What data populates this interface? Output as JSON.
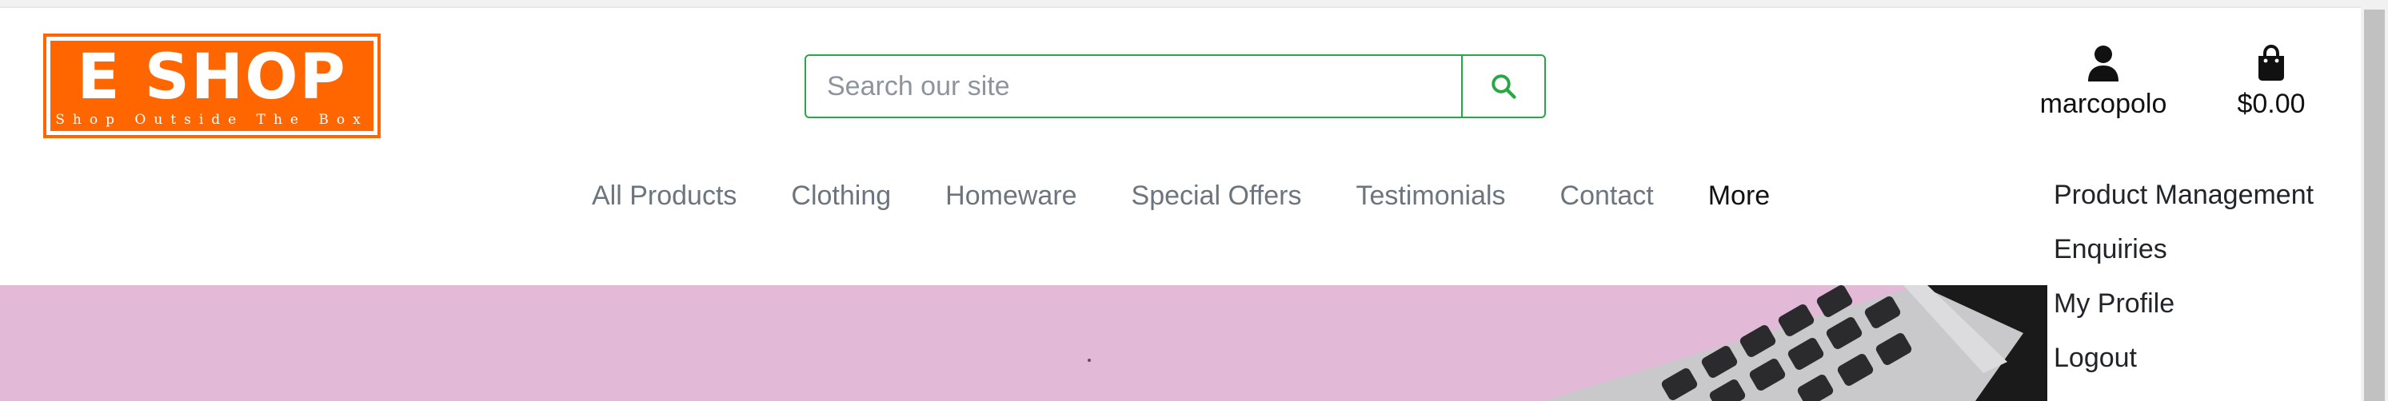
{
  "brand": {
    "title": "E SHOP",
    "tagline": "Shop Outside The Box",
    "color": "#ff6600"
  },
  "search": {
    "placeholder": "Search our site",
    "value": "",
    "button_icon": "search-icon",
    "accent": "#28a745"
  },
  "account": {
    "icon": "user-icon",
    "label": "marcopolo"
  },
  "bag": {
    "icon": "shopping-bag-icon",
    "label": "$0.00"
  },
  "nav": {
    "items": [
      {
        "label": "All Products"
      },
      {
        "label": "Clothing"
      },
      {
        "label": "Homeware"
      },
      {
        "label": "Special Offers"
      },
      {
        "label": "Testimonials"
      },
      {
        "label": "Contact"
      },
      {
        "label": "More"
      }
    ]
  },
  "account_menu": {
    "items": [
      {
        "label": "Product Management"
      },
      {
        "label": "Enquiries"
      },
      {
        "label": "My Profile"
      },
      {
        "label": "Logout"
      }
    ]
  },
  "hero": {
    "background": "#e2b9d6",
    "image": "laptop-keyboard-image"
  }
}
